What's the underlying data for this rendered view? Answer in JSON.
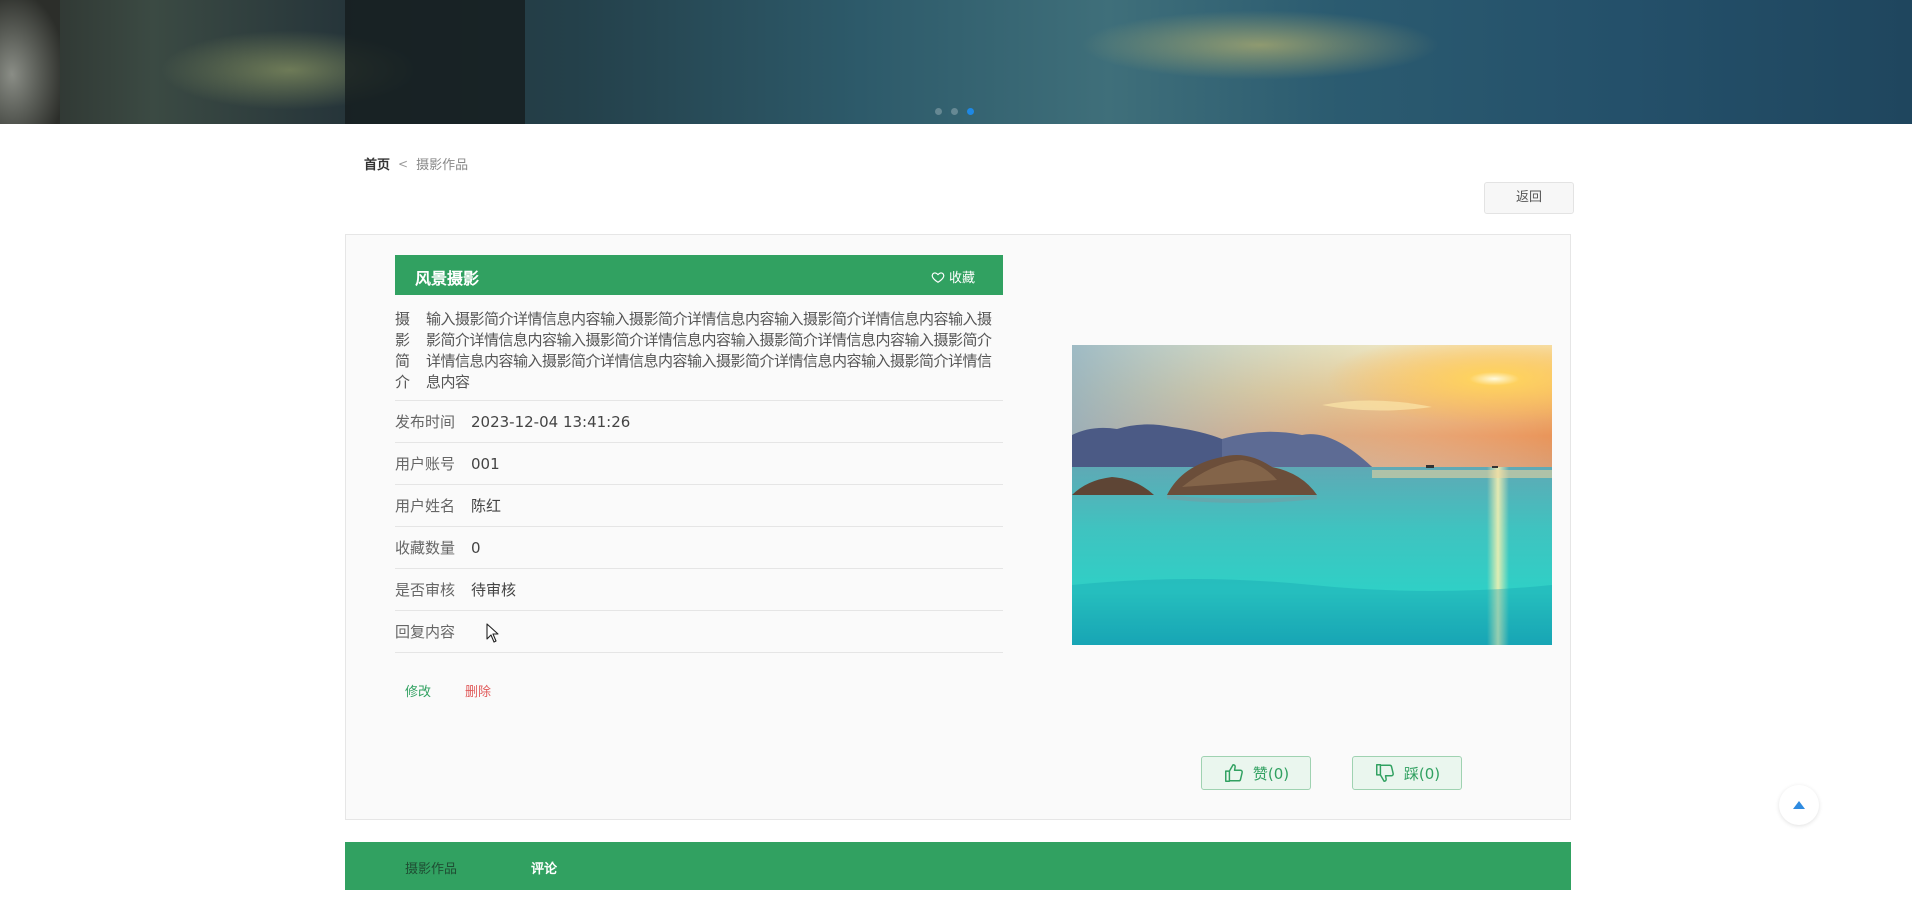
{
  "breadcrumb": {
    "home": "首页",
    "separator": "<",
    "current": "摄影作品"
  },
  "back_button": "返回",
  "work": {
    "title": "风景摄影",
    "favorite_label": "收藏",
    "intro_label": "摄影简介",
    "intro_text": "输入摄影简介详情信息内容输入摄影简介详情信息内容输入摄影简介详情信息内容输入摄影简介详情信息内容输入摄影简介详情信息内容输入摄影简介详情信息内容输入摄影简介详情信息内容输入摄影简介详情信息内容输入摄影简介详情信息内容输入摄影简介详情信息内容",
    "fields": [
      {
        "key": "发布时间",
        "value": "2023-12-04 13:41:26"
      },
      {
        "key": "用户账号",
        "value": "001"
      },
      {
        "key": "用户姓名",
        "value": "陈红"
      },
      {
        "key": "收藏数量",
        "value": "0"
      },
      {
        "key": "是否审核",
        "value": "待审核"
      },
      {
        "key": "回复内容",
        "value": ""
      }
    ],
    "edit_label": "修改",
    "delete_label": "删除",
    "like_label": "赞(0)",
    "dislike_label": "踩(0)"
  },
  "tabs": [
    {
      "label": "摄影作品"
    },
    {
      "label": "评论"
    }
  ],
  "banner": {
    "slides": 3,
    "active_slide": 3
  },
  "colors": {
    "primary": "#31a161",
    "danger": "#e05a5a",
    "dot_active": "#1e88e5"
  },
  "icons": [
    "heart-icon",
    "thumbs-up-icon",
    "thumbs-down-icon",
    "arrow-up-icon"
  ]
}
